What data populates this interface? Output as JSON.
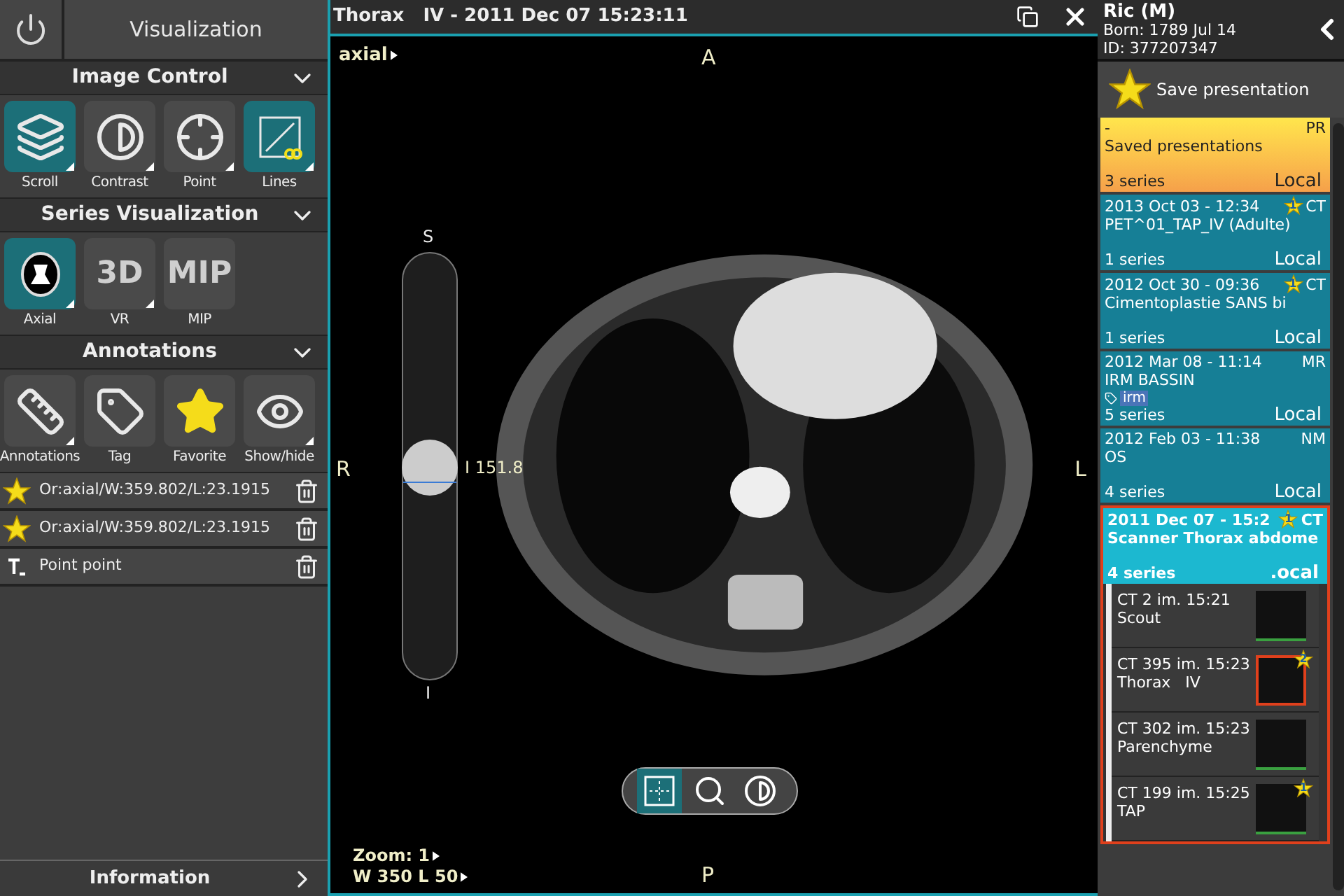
{
  "left_panel": {
    "title": "Visualization",
    "sections": [
      {
        "title": "Image Control",
        "expanded": true,
        "tools": [
          {
            "label": "Scroll",
            "kind": "icon",
            "selected": true,
            "has_menu": true
          },
          {
            "label": "Contrast",
            "kind": "icon",
            "selected": false,
            "has_menu": true
          },
          {
            "label": "Point",
            "kind": "icon",
            "selected": false,
            "has_menu": true
          },
          {
            "label": "Lines",
            "kind": "icon",
            "selected": true,
            "has_menu": true
          }
        ]
      },
      {
        "title": "Series Visualization",
        "expanded": true,
        "tools": [
          {
            "label": "Axial",
            "kind": "icon",
            "selected": true,
            "has_menu": true
          },
          {
            "label": "VR",
            "kind": "text",
            "text": "3D",
            "selected": false,
            "has_menu": true
          },
          {
            "label": "MIP",
            "kind": "text",
            "text": "MIP",
            "selected": false,
            "has_menu": false
          }
        ]
      },
      {
        "title": "Annotations",
        "expanded": true,
        "tools": [
          {
            "label": "Annotations",
            "kind": "icon",
            "selected": false,
            "has_menu": true
          },
          {
            "label": "Tag",
            "kind": "icon",
            "selected": false,
            "has_menu": false
          },
          {
            "label": "Favorite",
            "kind": "icon",
            "selected": false,
            "has_menu": false
          },
          {
            "label": "Show/hide",
            "kind": "icon",
            "selected": false,
            "has_menu": true
          }
        ]
      }
    ],
    "annotations": [
      {
        "kind": "favorite",
        "label": "Or:axial/W:359.802/L:23.1915"
      },
      {
        "kind": "favorite",
        "label": "Or:axial/W:359.802/L:23.1915"
      },
      {
        "kind": "text",
        "label": "Point point"
      }
    ],
    "footer": "Information"
  },
  "viewer": {
    "title": "Thorax   IV - 2011 Dec 07 15:23:11",
    "view": "axial",
    "orientation": {
      "top": "A",
      "bottom": "P",
      "left": "R",
      "right": "L"
    },
    "slider": {
      "top": "S",
      "bottom": "I",
      "reading": "I 151.8",
      "level": 0.5
    },
    "tools": [
      {
        "selected": true
      },
      {
        "selected": false
      },
      {
        "selected": false
      }
    ],
    "zoom": "Zoom: 1",
    "window_level": "W 350 L 50"
  },
  "right_panel": {
    "patient": {
      "name": "Ric (M)",
      "born": "Born: 1789 Jul 14",
      "id": "ID: 377207347"
    },
    "save": "Save presentation",
    "studies": [
      {
        "kind": "saved",
        "date": "-",
        "modality": "PR",
        "description": "Saved presentations",
        "series": "3 series",
        "location": "Local",
        "selected": false
      },
      {
        "kind": "study",
        "date": "2013 Oct 03 - 12:34",
        "star": "1",
        "modality": "CT",
        "description": "PET^01_TAP_IV (Adulte)",
        "series": "1 series",
        "location": "Local",
        "selected": false
      },
      {
        "kind": "study",
        "date": "2012 Oct 30 - 09:36",
        "star": "1",
        "modality": "CT",
        "description": "Cimentoplastie SANS bi",
        "series": "1 series",
        "location": "Local",
        "selected": false
      },
      {
        "kind": "study",
        "date": "2012 Mar 08 - 11:14",
        "modality": "MR",
        "description": "IRM BASSIN",
        "tag": "irm",
        "series": "5 series",
        "location": "Local",
        "selected": false
      },
      {
        "kind": "study",
        "date": "2012 Feb 03 - 11:38",
        "modality": "NM",
        "description": "OS",
        "series": "4 series",
        "location": "Local",
        "selected": false
      },
      {
        "kind": "study",
        "date": "2011 Dec 07 - 15:2",
        "star": "1",
        "modality": "CT",
        "description": "Scanner Thorax abdome",
        "series": "4 series",
        "location": ".ocal",
        "selected": true,
        "children": [
          {
            "title": "CT 2 im. 15:21",
            "name": "Scout",
            "selected": false
          },
          {
            "title": "CT 395 im. 15:23",
            "name": "Thorax   IV",
            "star": "2",
            "selected": true
          },
          {
            "title": "CT 302 im. 15:23",
            "name": "Parenchyme",
            "selected": false
          },
          {
            "title": "CT 199 im. 15:25",
            "name": "TAP",
            "star": "1",
            "selected": false
          }
        ]
      }
    ]
  }
}
